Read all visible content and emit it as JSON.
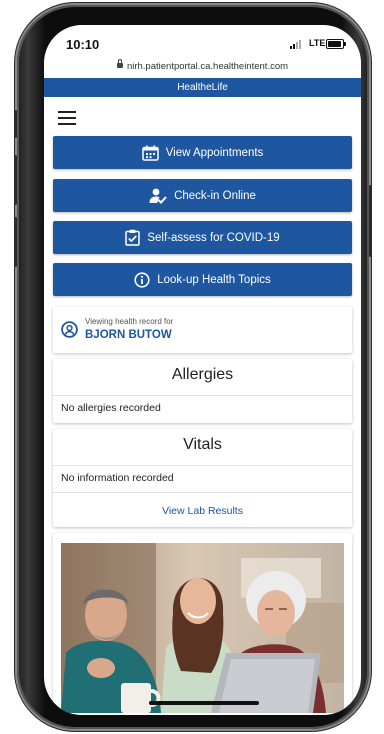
{
  "status_bar": {
    "time": "10:10",
    "network": "LTE"
  },
  "browser": {
    "url": "nirh.patientportal.ca.healtheintent.com"
  },
  "brand": {
    "title": "HealtheLife"
  },
  "menu": {
    "icon": "hamburger-menu-icon"
  },
  "actions": [
    {
      "label": "View Appointments",
      "icon": "calendar-icon"
    },
    {
      "label": "Check-in Online",
      "icon": "person-check-icon"
    },
    {
      "label": "Self-assess for COVID-19",
      "icon": "clipboard-check-icon"
    },
    {
      "label": "Look-up Health Topics",
      "icon": "info-icon"
    }
  ],
  "record": {
    "label": "Viewing health record for",
    "name": "BJORN BUTOW"
  },
  "allergies": {
    "title": "Allergies",
    "text": "No allergies recorded"
  },
  "vitals": {
    "title": "Vitals",
    "text": "No information recorded",
    "link": "View Lab Results"
  },
  "colors": {
    "primary": "#1e56a0",
    "text": "#222222"
  }
}
